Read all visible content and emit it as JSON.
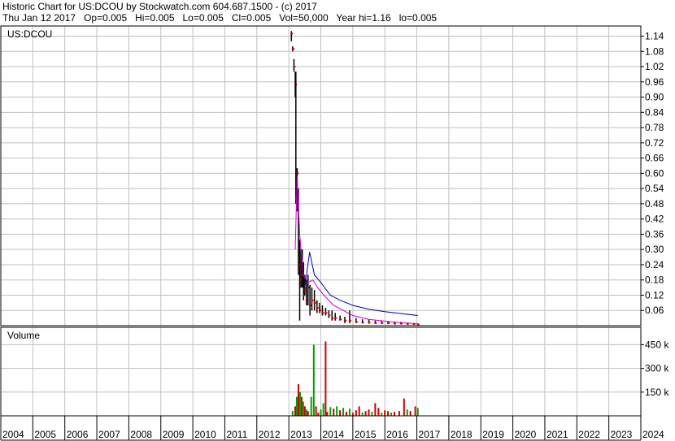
{
  "header": {
    "line1": "Historic Chart for US:DCOU by Stockwatch.com 604.687.1500 - (c) 2017",
    "line2": "Thu Jan 12 2017   Op=0.005   Hi=0.005   Lo=0.005   Cl=0.005   Vol=50,000   Year hi=1.16   lo=0.005"
  },
  "colors": {
    "grid": "#c0c0c0",
    "price_bar": "#000000",
    "close_marker": "#cc0000",
    "ma_short": "#d000d0",
    "ma_long": "#0000c0",
    "vol_up": "#00a000",
    "vol_down": "#cc0000"
  },
  "chart_data": [
    {
      "type": "line",
      "title": "US:DCOU",
      "x_unit": "year",
      "ylim": [
        0,
        1.18
      ],
      "y_ticks": [
        "1.14",
        "1.08",
        "1.02",
        "0.96",
        "0.90",
        "0.84",
        "0.78",
        "0.72",
        "0.66",
        "0.60",
        "0.54",
        "0.48",
        "0.42",
        "0.36",
        "0.30",
        "0.24",
        "0.18",
        "0.12",
        "0.06"
      ],
      "grid": true,
      "series": [
        {
          "role": "price",
          "x": [
            2013.08,
            2013.12,
            2013.16,
            2013.2,
            2013.22,
            2013.26,
            2013.3,
            2013.34,
            2013.38,
            2013.42,
            2013.46,
            2013.5,
            2013.55,
            2013.6,
            2013.66,
            2013.72,
            2013.8,
            2013.88,
            2013.96,
            2014.05,
            2014.15,
            2014.25,
            2014.35,
            2014.45,
            2014.6,
            2014.75,
            2014.9,
            2015.1,
            2015.3,
            2015.5,
            2015.7,
            2015.9,
            2016.1,
            2016.3,
            2016.5,
            2016.7,
            2016.9,
            2017.03
          ],
          "high": [
            1.16,
            1.1,
            1.05,
            1.0,
            1.0,
            0.62,
            0.54,
            0.34,
            0.3,
            0.3,
            0.25,
            0.2,
            0.18,
            0.2,
            0.16,
            0.15,
            0.14,
            0.1,
            0.09,
            0.08,
            0.07,
            0.06,
            0.06,
            0.05,
            0.04,
            0.035,
            0.06,
            0.03,
            0.025,
            0.025,
            0.02,
            0.02,
            0.018,
            0.015,
            0.015,
            0.012,
            0.01,
            0.005
          ],
          "low": [
            1.12,
            1.08,
            1.0,
            0.9,
            0.48,
            0.45,
            0.2,
            0.02,
            0.15,
            0.15,
            0.1,
            0.12,
            0.08,
            0.08,
            0.04,
            0.06,
            0.06,
            0.05,
            0.05,
            0.04,
            0.04,
            0.03,
            0.02,
            0.02,
            0.02,
            0.01,
            0.01,
            0.01,
            0.01,
            0.008,
            0.008,
            0.008,
            0.006,
            0.006,
            0.005,
            0.005,
            0.005,
            0.005
          ],
          "close": [
            1.15,
            1.09,
            1.02,
            0.95,
            0.5,
            0.6,
            0.22,
            0.24,
            0.18,
            0.2,
            0.12,
            0.14,
            0.1,
            0.15,
            0.08,
            0.1,
            0.09,
            0.07,
            0.06,
            0.05,
            0.05,
            0.04,
            0.03,
            0.03,
            0.025,
            0.02,
            0.02,
            0.015,
            0.012,
            0.012,
            0.01,
            0.01,
            0.01,
            0.008,
            0.008,
            0.007,
            0.006,
            0.005
          ]
        },
        {
          "role": "moving-average-short",
          "x": [
            2013.2,
            2013.26,
            2013.34,
            2013.45,
            2013.6,
            2013.75,
            2013.9,
            2014.1,
            2014.4,
            2014.7,
            2015.0,
            2015.5,
            2016.0,
            2016.5,
            2017.03
          ],
          "values": [
            0.3,
            0.59,
            0.36,
            0.2,
            0.17,
            0.18,
            0.15,
            0.12,
            0.08,
            0.06,
            0.04,
            0.025,
            0.018,
            0.012,
            0.008
          ]
        },
        {
          "role": "moving-average-long",
          "x": [
            2013.5,
            2013.65,
            2013.8,
            2014.0,
            2014.3,
            2014.6,
            2015.0,
            2015.5,
            2016.0,
            2016.5,
            2017.03
          ],
          "values": [
            0.15,
            0.29,
            0.2,
            0.17,
            0.12,
            0.1,
            0.08,
            0.065,
            0.055,
            0.048,
            0.04
          ]
        }
      ]
    },
    {
      "type": "bar",
      "title": "Volume",
      "x_unit": "year",
      "ylim": [
        0,
        560000
      ],
      "y_ticks": [
        "450 k",
        "300 k",
        "150 k"
      ],
      "grid": true,
      "bars": [
        {
          "x": 2013.12,
          "v": 30000,
          "c": "up"
        },
        {
          "x": 2013.2,
          "v": 60000,
          "c": "down"
        },
        {
          "x": 2013.25,
          "v": 120000,
          "c": "up"
        },
        {
          "x": 2013.3,
          "v": 200000,
          "c": "down"
        },
        {
          "x": 2013.35,
          "v": 150000,
          "c": "up"
        },
        {
          "x": 2013.4,
          "v": 120000,
          "c": "down"
        },
        {
          "x": 2013.45,
          "v": 90000,
          "c": "up"
        },
        {
          "x": 2013.5,
          "v": 60000,
          "c": "down"
        },
        {
          "x": 2013.55,
          "v": 40000,
          "c": "up"
        },
        {
          "x": 2013.6,
          "v": 30000,
          "c": "down"
        },
        {
          "x": 2013.7,
          "v": 120000,
          "c": "up"
        },
        {
          "x": 2013.78,
          "v": 450000,
          "c": "up"
        },
        {
          "x": 2013.85,
          "v": 60000,
          "c": "down"
        },
        {
          "x": 2013.92,
          "v": 20000,
          "c": "down"
        },
        {
          "x": 2014.0,
          "v": 40000,
          "c": "up"
        },
        {
          "x": 2014.08,
          "v": 80000,
          "c": "up"
        },
        {
          "x": 2014.15,
          "v": 470000,
          "c": "down"
        },
        {
          "x": 2014.2,
          "v": 25000,
          "c": "down"
        },
        {
          "x": 2014.3,
          "v": 55000,
          "c": "up"
        },
        {
          "x": 2014.4,
          "v": 45000,
          "c": "down"
        },
        {
          "x": 2014.5,
          "v": 60000,
          "c": "up"
        },
        {
          "x": 2014.6,
          "v": 35000,
          "c": "down"
        },
        {
          "x": 2014.7,
          "v": 50000,
          "c": "up"
        },
        {
          "x": 2014.8,
          "v": 25000,
          "c": "down"
        },
        {
          "x": 2014.9,
          "v": 45000,
          "c": "up"
        },
        {
          "x": 2015.0,
          "v": 20000,
          "c": "down"
        },
        {
          "x": 2015.1,
          "v": 35000,
          "c": "down"
        },
        {
          "x": 2015.2,
          "v": 60000,
          "c": "down"
        },
        {
          "x": 2015.3,
          "v": 20000,
          "c": "up"
        },
        {
          "x": 2015.4,
          "v": 30000,
          "c": "down"
        },
        {
          "x": 2015.5,
          "v": 40000,
          "c": "down"
        },
        {
          "x": 2015.6,
          "v": 25000,
          "c": "up"
        },
        {
          "x": 2015.7,
          "v": 80000,
          "c": "down"
        },
        {
          "x": 2015.8,
          "v": 50000,
          "c": "down"
        },
        {
          "x": 2015.9,
          "v": 20000,
          "c": "up"
        },
        {
          "x": 2016.0,
          "v": 35000,
          "c": "down"
        },
        {
          "x": 2016.1,
          "v": 30000,
          "c": "down"
        },
        {
          "x": 2016.2,
          "v": 20000,
          "c": "up"
        },
        {
          "x": 2016.3,
          "v": 25000,
          "c": "down"
        },
        {
          "x": 2016.45,
          "v": 30000,
          "c": "down"
        },
        {
          "x": 2016.6,
          "v": 110000,
          "c": "down"
        },
        {
          "x": 2016.7,
          "v": 40000,
          "c": "up"
        },
        {
          "x": 2016.8,
          "v": 30000,
          "c": "down"
        },
        {
          "x": 2016.95,
          "v": 60000,
          "c": "down"
        },
        {
          "x": 2017.03,
          "v": 50000,
          "c": "up"
        }
      ]
    }
  ],
  "x_axis": {
    "labels": [
      "2004",
      "2005",
      "2006",
      "2007",
      "2008",
      "2009",
      "2010",
      "2011",
      "2012",
      "2013",
      "2014",
      "2015",
      "2016",
      "2017",
      "2018",
      "2019",
      "2020",
      "2021",
      "2022",
      "2023",
      "2024"
    ]
  }
}
